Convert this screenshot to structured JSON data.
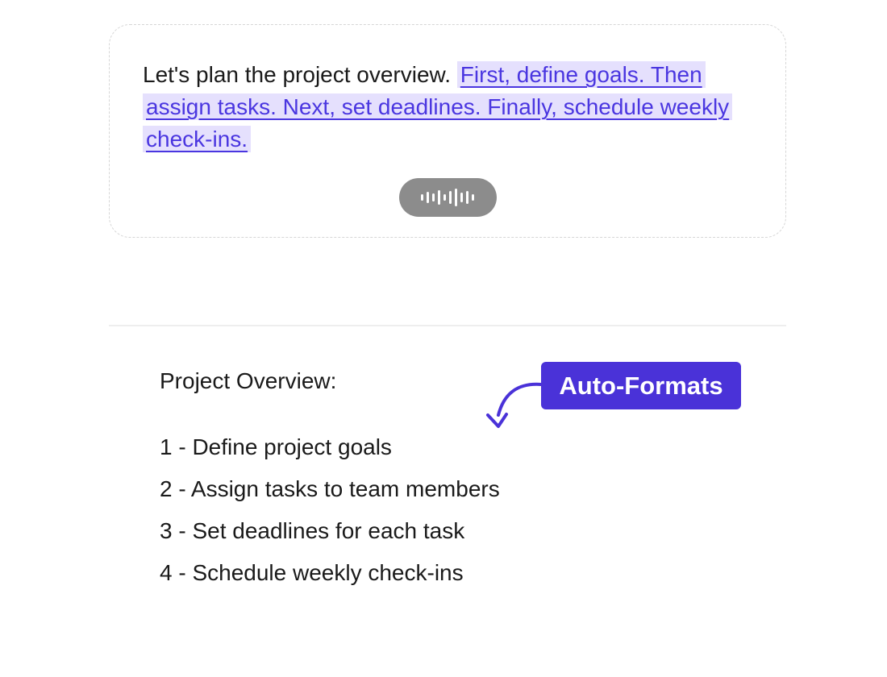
{
  "dictation": {
    "static_text": "Let's plan the project overview.",
    "live_text": "First, define goals. Then assign tasks. Next, set deadlines. Finally, schedule weekly check-ins.",
    "mic_icon": "audio-waveform-icon"
  },
  "output": {
    "heading": "Project Overview:",
    "items": [
      "1 - Define project goals",
      "2 - Assign tasks to team members",
      "3 - Set deadlines for each task",
      "4 - Schedule weekly check-ins"
    ]
  },
  "callout": {
    "label": "Auto-Formats",
    "icon": "curved-arrow-icon"
  },
  "colors": {
    "accent": "#4a32d8",
    "highlight_bg": "#e5e0fd",
    "highlight_text": "#4a36e0",
    "mic_pill": "#8c8c8c"
  }
}
